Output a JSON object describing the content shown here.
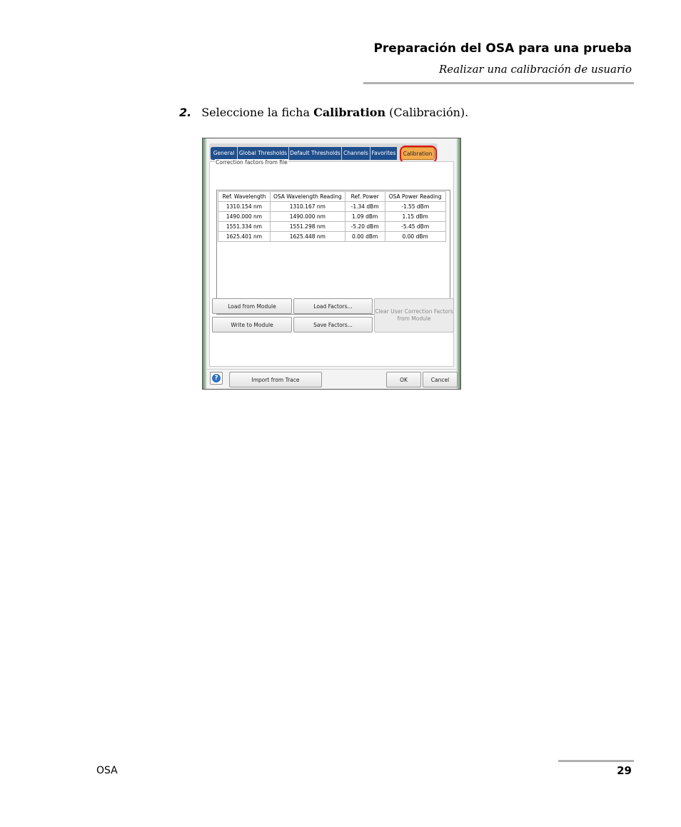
{
  "header": {
    "title": "Preparación del OSA para una prueba",
    "subtitle": "Realizar una calibración de usuario"
  },
  "step": {
    "number": "2.",
    "text_before": "Seleccione la ficha ",
    "bold": "Calibration",
    "text_after": " (Calibración)."
  },
  "dialog": {
    "tabs": [
      "General",
      "Global Thresholds",
      "Default Thresholds",
      "Channels",
      "Favorites",
      "Calibration"
    ],
    "active_tab": "Calibration",
    "highlight_color": "#e0101a",
    "group_label": "Correction factors from file",
    "table": {
      "headers": [
        "Ref. Wavelength",
        "OSA Wavelength Reading",
        "Ref. Power",
        "OSA Power Reading"
      ],
      "rows": [
        [
          "1310.154 nm",
          "1310.167 nm",
          "-1.34 dBm",
          "-1.55 dBm"
        ],
        [
          "1490.000 nm",
          "1490.000 nm",
          "1.09 dBm",
          "1.15 dBm"
        ],
        [
          "1551.334 nm",
          "1551.298 nm",
          "-5.20 dBm",
          "-5.45 dBm"
        ],
        [
          "1625.401 nm",
          "1625.448 nm",
          "0.00 dBm",
          "0.00 dBm"
        ]
      ]
    },
    "buttons": {
      "load_from_module": "Load from Module",
      "load_factors": "Load Factors...",
      "clear_user": "Clear User Correction Factors from Module",
      "write_to_module": "Write to Module",
      "save_factors": "Save Factors...",
      "import_from_trace": "Import from Trace",
      "ok": "OK",
      "cancel": "Cancel",
      "help": "?"
    }
  },
  "footer": {
    "left": "OSA",
    "page": "29"
  }
}
